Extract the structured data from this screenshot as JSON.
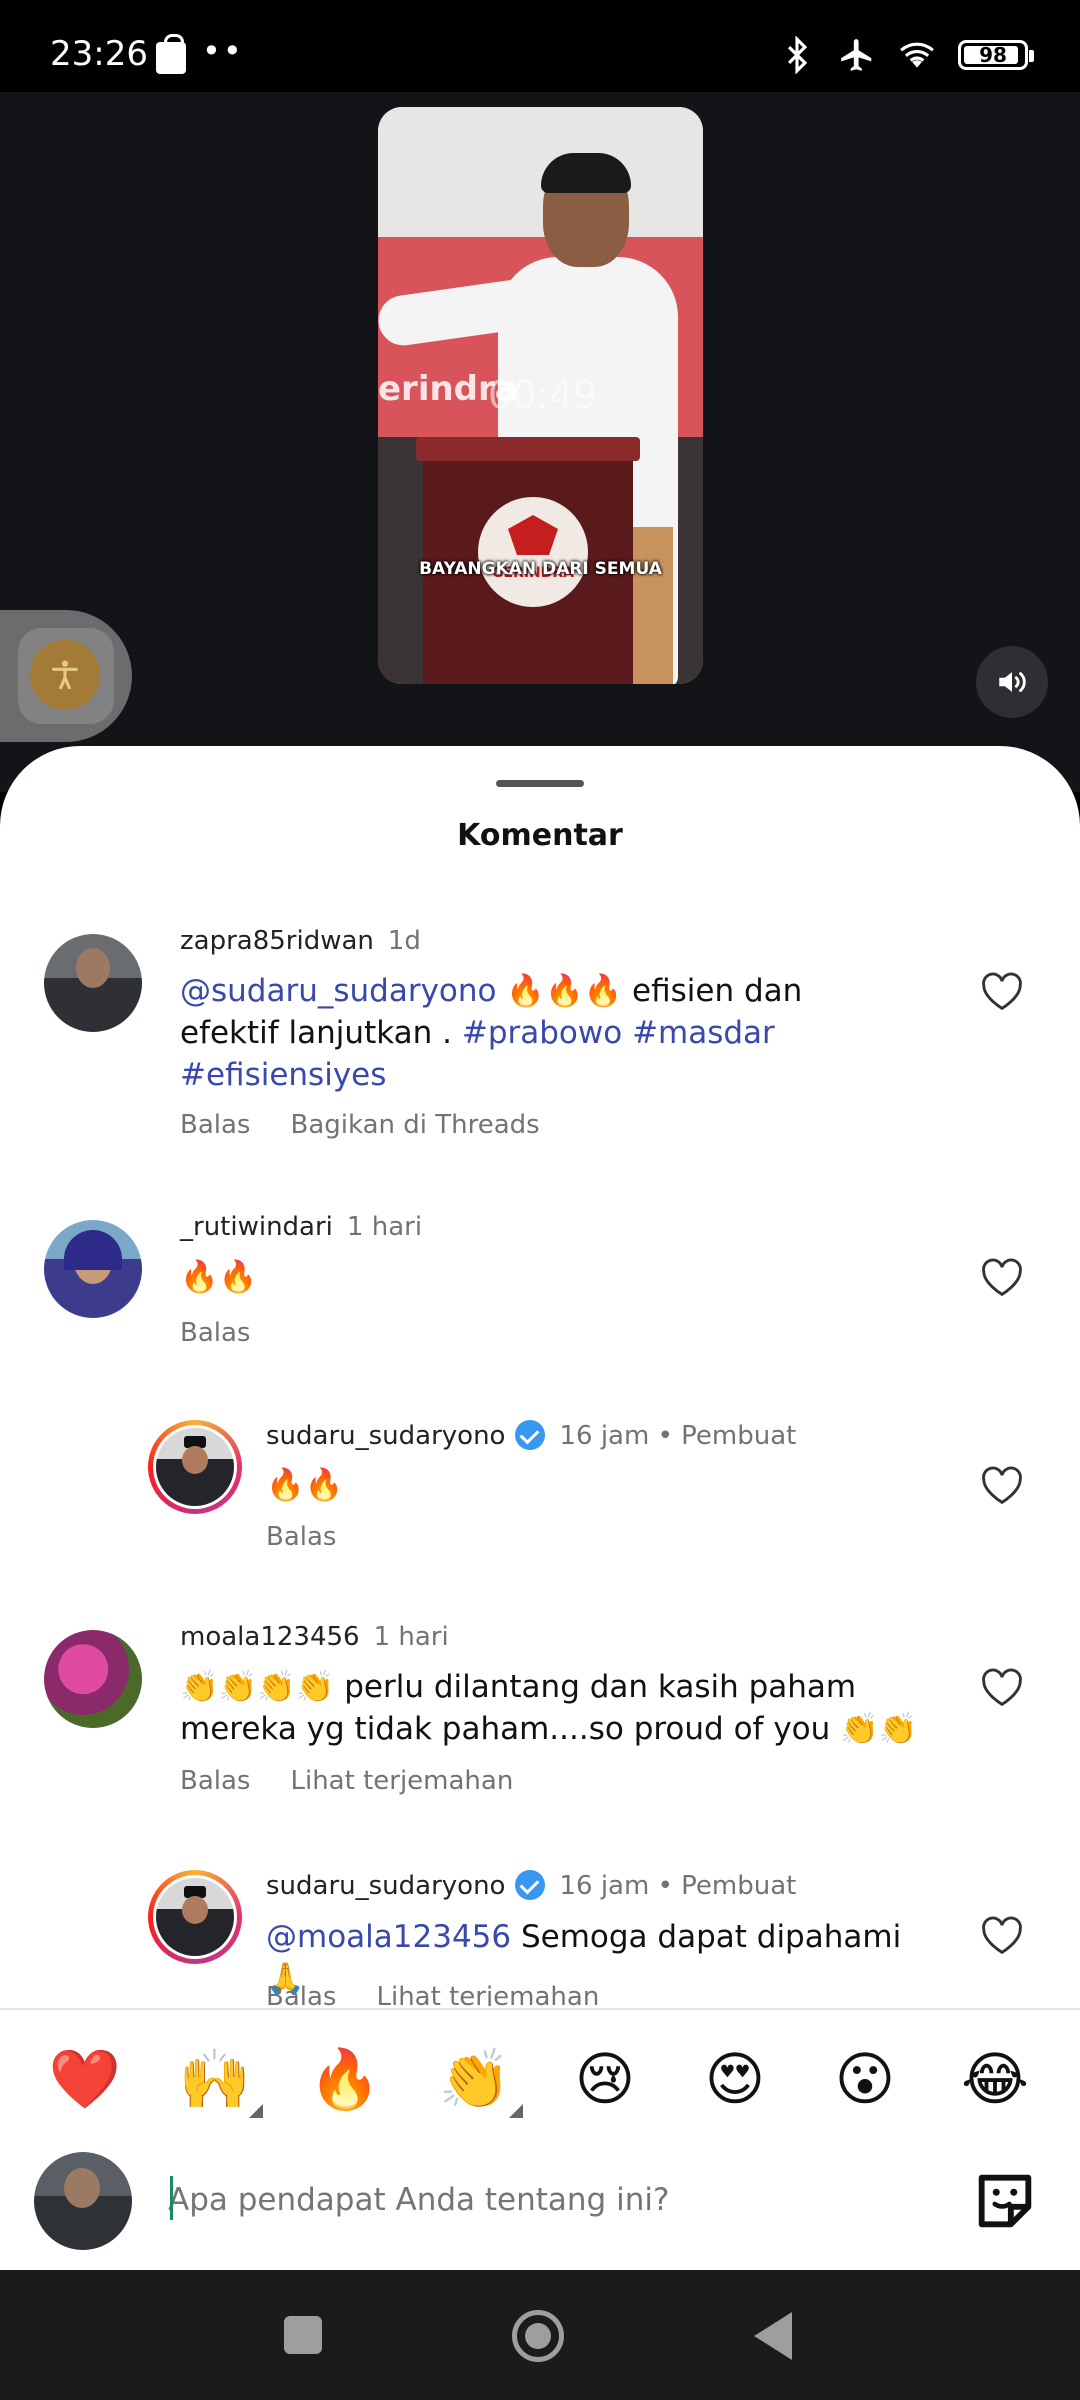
{
  "status_bar": {
    "time": "23:26",
    "dots": "••",
    "battery": "98"
  },
  "video": {
    "brand": "erindra",
    "timer": "00:49",
    "caption": "BAYANGKAN DARI SEMUA",
    "podium_logo": "GERINDRA"
  },
  "sheet": {
    "title": "Komentar"
  },
  "comments": [
    {
      "username": "zapra85ridwan",
      "time": "1d",
      "mention": "@sudaru_sudaryono",
      "text_line1_rest": " 🔥🔥🔥 efisien dan",
      "text_line2_plain": "efektif  lanjutkan . ",
      "hashtag1": "#prabowo",
      "hashtag2": "#masdar",
      "hashtag3": "#efisiensiyes",
      "reply": "Balas",
      "extra": "Bagikan di Threads"
    },
    {
      "username": "_rutiwindari",
      "time": "1 hari",
      "text": "🔥🔥",
      "reply": "Balas"
    },
    {
      "username": "sudaru_sudaryono",
      "time": "16 jam • Pembuat",
      "text": "🔥🔥",
      "reply": "Balas"
    },
    {
      "username": "moala123456",
      "time": "1 hari",
      "text_line1": "👏👏👏👏 perlu dilantang dan kasih paham",
      "text_line2": "mereka yg tidak paham....so proud of you 👏👏",
      "reply": "Balas",
      "extra": "Lihat terjemahan"
    },
    {
      "username": "sudaru_sudaryono",
      "time": "16 jam • Pembuat",
      "mention": "@moala123456",
      "text_rest": " Semoga dapat dipahami 🙏",
      "reply": "Balas",
      "extra": "Lihat terjemahan"
    }
  ],
  "reactions": [
    "❤️",
    "🙌",
    "🔥",
    "👏",
    "😢",
    "😍",
    "😮",
    "😂"
  ],
  "compose": {
    "placeholder": "Apa pendapat Anda tentang ini?"
  },
  "colors": {
    "mention": "#3949ab",
    "verified": "#3897f0",
    "meta_grey": "#737373"
  }
}
